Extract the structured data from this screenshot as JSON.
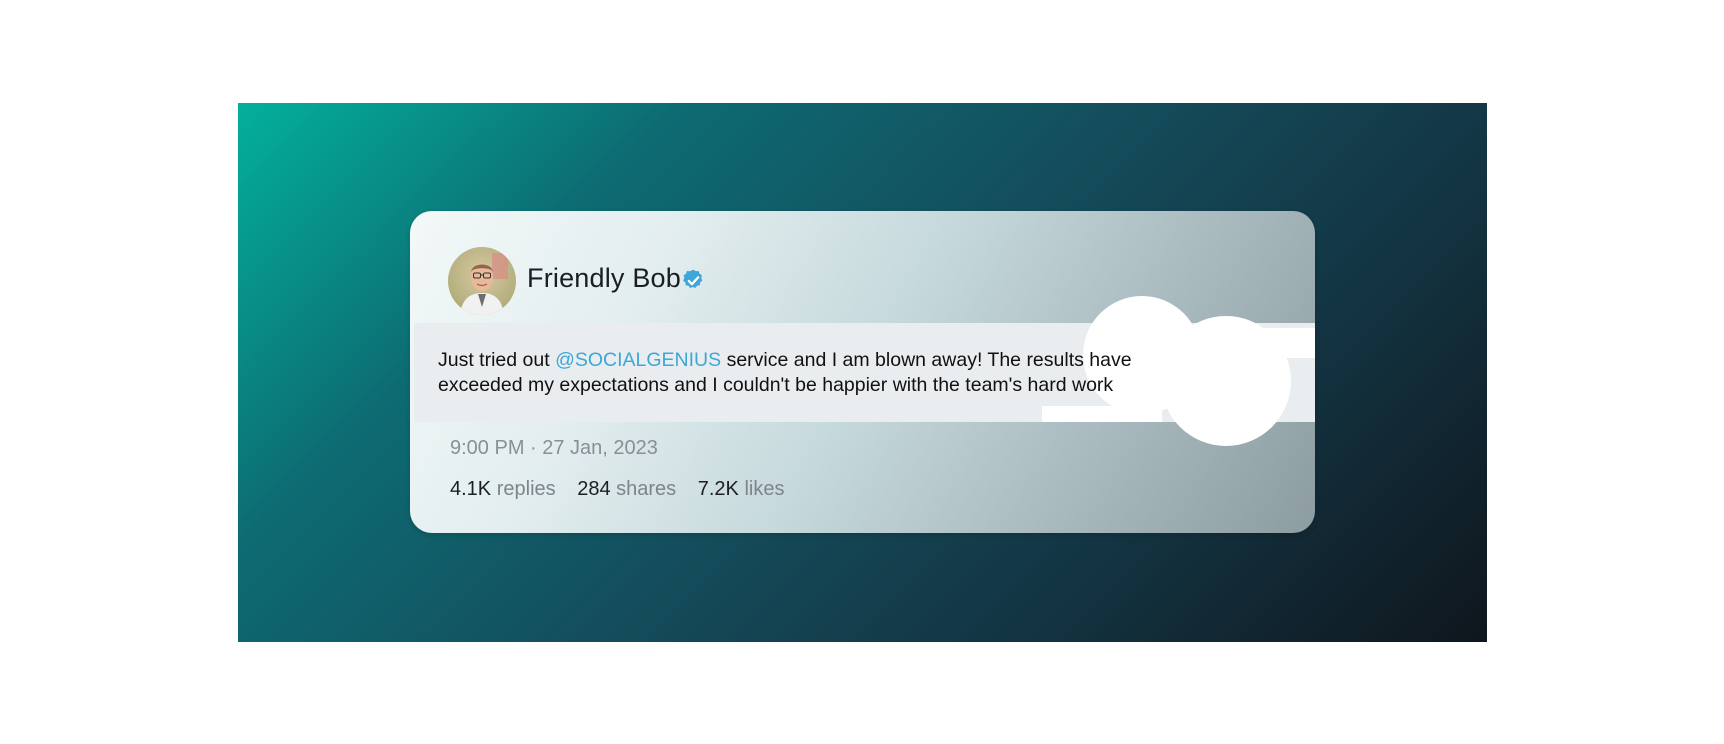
{
  "tweet": {
    "author": "Friendly Bob",
    "verified_icon": "verified-badge-icon",
    "text_before": "Just tried out ",
    "mention": "@SOCIALGENIUS",
    "text_after": " service and I am blown away! The results have exceeded my expectations and I couldn't be happier with the team's hard work",
    "timestamp": "9:00 PM · 27 Jan, 2023",
    "stats": [
      {
        "value": "4.1K",
        "label": "replies"
      },
      {
        "value": "284",
        "label": "shares"
      },
      {
        "value": "7.2K",
        "label": "likes"
      }
    ]
  },
  "colors": {
    "mention": "#3ea7d8",
    "verified": "#3ea7d8",
    "gradient_start": "#03b09c",
    "gradient_end": "#0f161d"
  }
}
